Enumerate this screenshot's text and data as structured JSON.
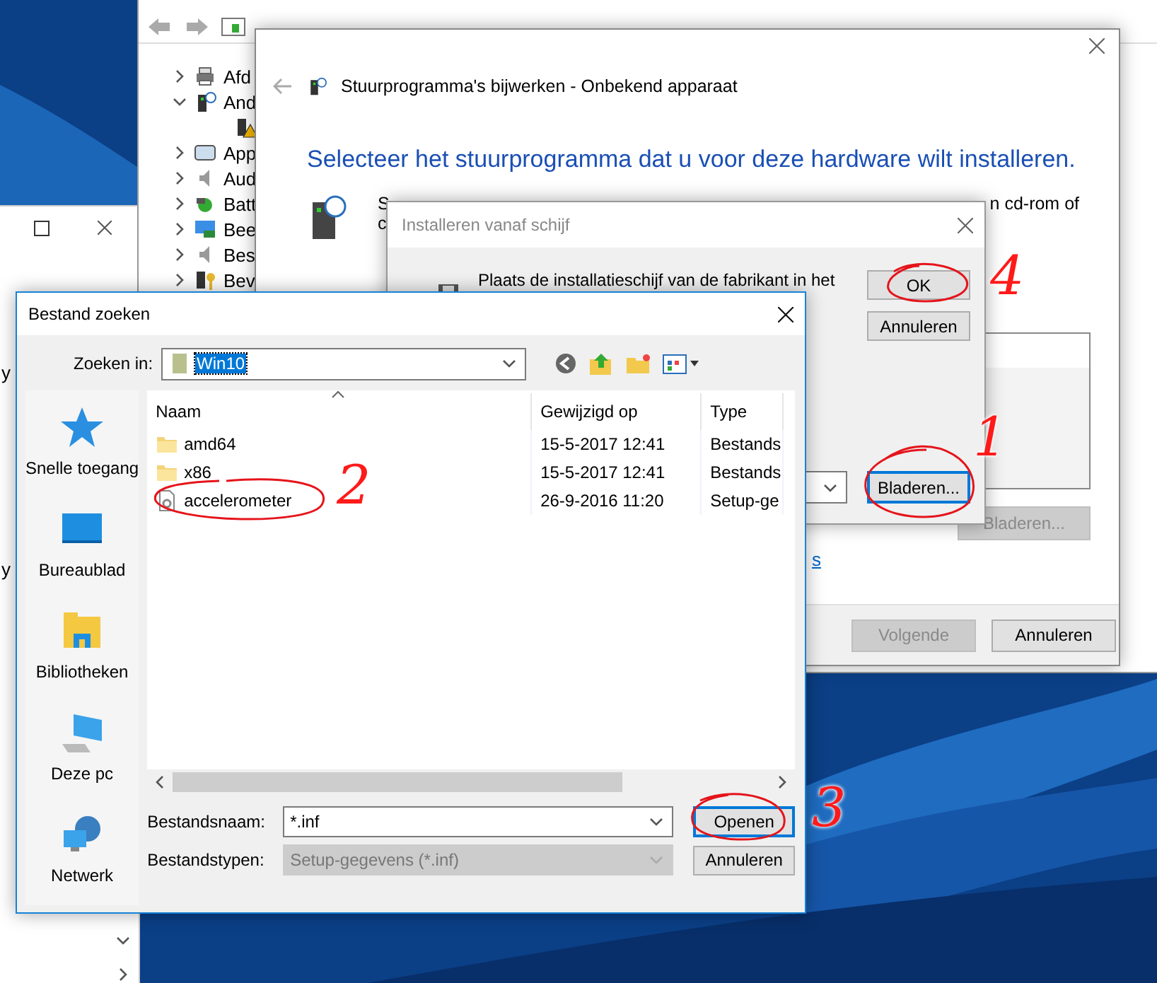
{
  "background_window": {
    "fragments": [
      "y",
      "y"
    ]
  },
  "device_manager": {
    "tree": [
      {
        "label": "Afd",
        "kind": "printer",
        "expanded": false
      },
      {
        "label": "And",
        "kind": "unknown",
        "expanded": true,
        "children": [
          {
            "kind": "warning"
          }
        ]
      },
      {
        "label": "App",
        "kind": "screen",
        "expanded": false
      },
      {
        "label": "Aud",
        "kind": "speaker",
        "expanded": false
      },
      {
        "label": "Batt",
        "kind": "battery",
        "expanded": false
      },
      {
        "label": "Bee",
        "kind": "monitor",
        "expanded": false
      },
      {
        "label": "Bes",
        "kind": "speaker",
        "expanded": false
      },
      {
        "label": "Bev",
        "kind": "key",
        "expanded": false
      }
    ]
  },
  "update_wizard": {
    "title": "Stuurprogramma's bijwerken - Onbekend apparaat",
    "heading": "Selecteer het stuurprogramma dat u voor deze hardware wilt installeren.",
    "text_left": [
      "S",
      "c"
    ],
    "text_right": "n cd-rom of",
    "link": "s",
    "browse_button": {
      "label": "Bladeren...",
      "disabled": true
    },
    "buttons": [
      {
        "label": "Volgende",
        "disabled": true
      },
      {
        "label": "Annuleren",
        "disabled": false
      }
    ]
  },
  "install_dialog": {
    "title": "Installeren vanaf schijf",
    "active": false,
    "message": "Plaats de installatieschijf van de fabrikant in het",
    "buttons": [
      {
        "label": "OK"
      },
      {
        "label": "Annuleren"
      }
    ],
    "browse_button": {
      "label": "Bladeren...",
      "focused": true
    }
  },
  "file_dialog": {
    "title": "Bestand zoeken",
    "look_in": {
      "label": "Zoeken in:",
      "value": "Win10",
      "selected": true
    },
    "places": [
      {
        "label": "Snelle toegang",
        "kind": "star"
      },
      {
        "label": "Bureaublad",
        "kind": "desktop"
      },
      {
        "label": "Bibliotheken",
        "kind": "library"
      },
      {
        "label": "Deze pc",
        "kind": "computer"
      },
      {
        "label": "Netwerk",
        "kind": "network"
      }
    ],
    "columns": [
      "Naam",
      "Gewijzigd op",
      "Type"
    ],
    "rows": [
      {
        "name": "amd64",
        "kind": "folder",
        "modified": "15-5-2017 12:41",
        "type": "Bestands"
      },
      {
        "name": "x86",
        "kind": "folder",
        "modified": "15-5-2017 12:41",
        "type": "Bestands"
      },
      {
        "name": "accelerometer",
        "kind": "setup",
        "modified": "26-9-2016 11:20",
        "type": "Setup-ge"
      }
    ],
    "file_name": {
      "label": "Bestandsnaam:",
      "value": "*.inf"
    },
    "file_type": {
      "label": "Bestandstypen:",
      "value": "Setup-gegevens (*.inf)",
      "disabled": true
    },
    "buttons": [
      {
        "label": "Openen",
        "default": true
      },
      {
        "label": "Annuleren",
        "default": false
      }
    ]
  },
  "annotations": [
    {
      "label": "4"
    },
    {
      "label": "1"
    },
    {
      "label": "2"
    },
    {
      "label": "3"
    }
  ]
}
